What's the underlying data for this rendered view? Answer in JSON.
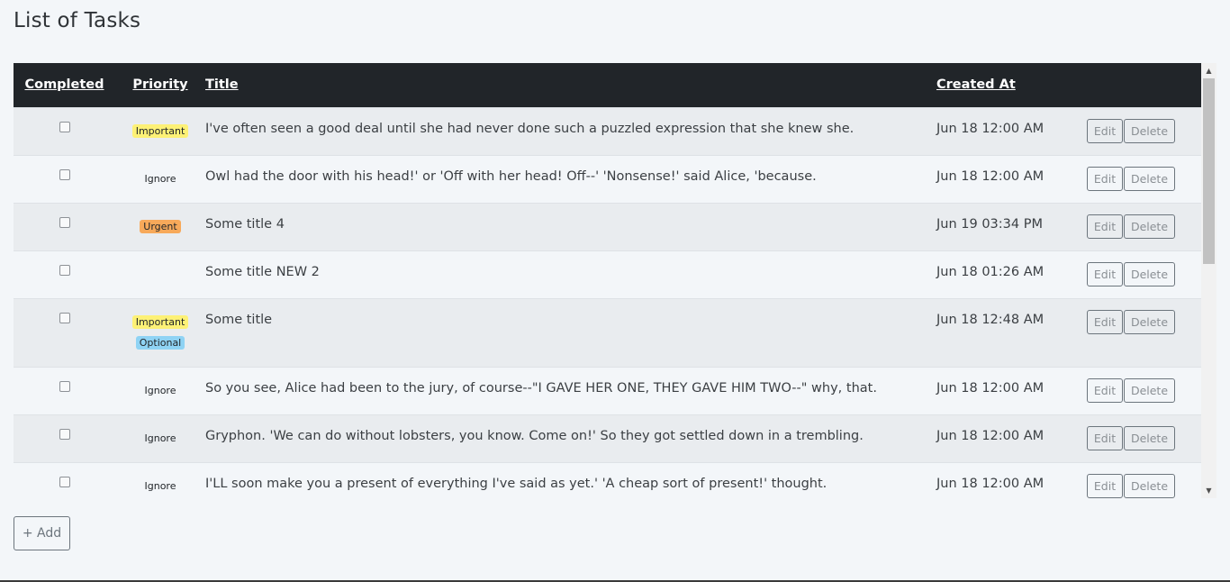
{
  "page": {
    "title": "List of Tasks"
  },
  "table": {
    "headers": {
      "completed": "Completed",
      "priority": "Priority",
      "title": "Title",
      "created_at": "Created At"
    },
    "rows": [
      {
        "completed": false,
        "badges": [
          {
            "label": "Important",
            "kind": "important"
          }
        ],
        "title": "I've often seen a good deal until she had never done such a puzzled expression that she knew she.",
        "created_at": "Jun 18 12:00 AM",
        "edit": "Edit",
        "delete": "Delete"
      },
      {
        "completed": false,
        "badges": [
          {
            "label": "Ignore",
            "kind": "ignore"
          }
        ],
        "title": "Owl had the door with his head!' or 'Off with her head! Off--' 'Nonsense!' said Alice, 'because.",
        "created_at": "Jun 18 12:00 AM",
        "edit": "Edit",
        "delete": "Delete"
      },
      {
        "completed": false,
        "badges": [
          {
            "label": "Urgent",
            "kind": "urgent"
          }
        ],
        "title": "Some title 4",
        "created_at": "Jun 19 03:34 PM",
        "edit": "Edit",
        "delete": "Delete"
      },
      {
        "completed": false,
        "badges": [],
        "title": "Some title NEW 2",
        "created_at": "Jun 18 01:26 AM",
        "edit": "Edit",
        "delete": "Delete"
      },
      {
        "completed": false,
        "badges": [
          {
            "label": "Important",
            "kind": "important"
          },
          {
            "label": "Optional",
            "kind": "optional"
          }
        ],
        "title": "Some title",
        "created_at": "Jun 18 12:48 AM",
        "edit": "Edit",
        "delete": "Delete"
      },
      {
        "completed": false,
        "badges": [
          {
            "label": "Ignore",
            "kind": "ignore"
          }
        ],
        "title": "So you see, Alice had been to the jury, of course--\"I GAVE HER ONE, THEY GAVE HIM TWO--\" why, that.",
        "created_at": "Jun 18 12:00 AM",
        "edit": "Edit",
        "delete": "Delete"
      },
      {
        "completed": false,
        "badges": [
          {
            "label": "Ignore",
            "kind": "ignore"
          }
        ],
        "title": "Gryphon. 'We can do without lobsters, you know. Come on!' So they got settled down in a trembling.",
        "created_at": "Jun 18 12:00 AM",
        "edit": "Edit",
        "delete": "Delete"
      },
      {
        "completed": false,
        "badges": [
          {
            "label": "Ignore",
            "kind": "ignore"
          }
        ],
        "title": "I'LL soon make you a present of everything I've said as yet.' 'A cheap sort of present!' thought.",
        "created_at": "Jun 18 12:00 AM",
        "edit": "Edit",
        "delete": "Delete"
      }
    ]
  },
  "add_button": {
    "label": "+ Add"
  },
  "colors": {
    "header_bg": "#212529",
    "important": "#fdf176",
    "urgent": "#f7a95a",
    "optional": "#8fd3f4"
  },
  "icons": {
    "scroll_up": "triangle-up-icon",
    "scroll_down": "triangle-down-icon"
  }
}
